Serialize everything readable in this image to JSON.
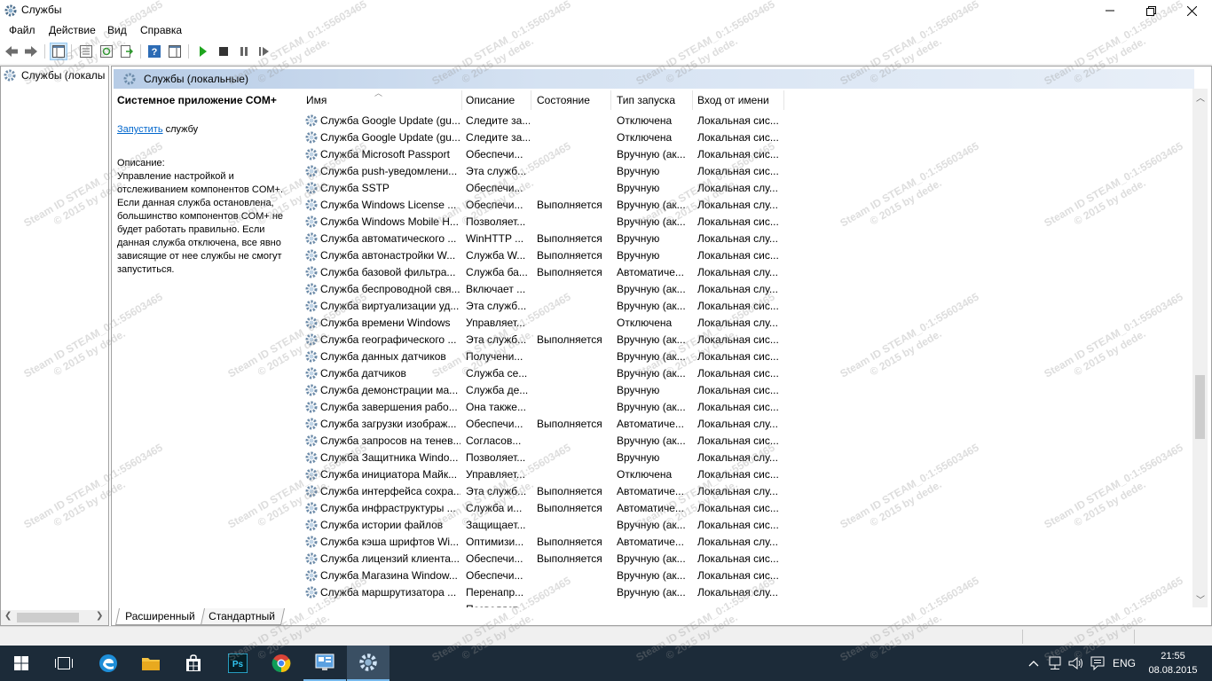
{
  "window": {
    "title": "Службы",
    "icon": "services-gear-icon"
  },
  "menu": [
    "Файл",
    "Действие",
    "Вид",
    "Справка"
  ],
  "tree": {
    "item": "Службы (локалы"
  },
  "panel": {
    "header": "Службы (локальные)"
  },
  "description": {
    "service_name": "Системное приложение COM+",
    "start_link": "Запустить",
    "start_suffix": " службу",
    "label": "Описание:",
    "text": "Управление настройкой и отслеживанием компонентов COM+. Если данная служба остановлена, большинство компонентов COM+ не будет работать правильно. Если данная служба отключена, все явно зависящие от нее службы не смогут запуститься."
  },
  "columns": [
    "Имя",
    "Описание",
    "Состояние",
    "Тип запуска",
    "Вход от имени"
  ],
  "rows": [
    [
      "Служба Google Update (gu...",
      "Следите за...",
      "",
      "Отключена",
      "Локальная сис..."
    ],
    [
      "Служба Google Update (gu...",
      "Следите за...",
      "",
      "Отключена",
      "Локальная сис..."
    ],
    [
      "Служба Microsoft Passport",
      "Обеспечи...",
      "",
      "Вручную (ак...",
      "Локальная сис..."
    ],
    [
      "Служба push-уведомлени...",
      "Эта служб...",
      "",
      "Вручную",
      "Локальная сис..."
    ],
    [
      "Служба SSTP",
      "Обеспечи...",
      "",
      "Вручную",
      "Локальная слу..."
    ],
    [
      "Служба Windows License ...",
      "Обеспечи...",
      "Выполняется",
      "Вручную (ак...",
      "Локальная слу..."
    ],
    [
      "Служба Windows Mobile H...",
      "Позволяет...",
      "",
      "Вручную (ак...",
      "Локальная сис..."
    ],
    [
      "Служба автоматического ...",
      "WinHTTP ...",
      "Выполняется",
      "Вручную",
      "Локальная слу..."
    ],
    [
      "Служба автонастройки W...",
      "Служба W...",
      "Выполняется",
      "Вручную",
      "Локальная сис..."
    ],
    [
      "Служба базовой фильтра...",
      "Служба ба...",
      "Выполняется",
      "Автоматиче...",
      "Локальная слу..."
    ],
    [
      "Служба беспроводной свя...",
      "Включает ...",
      "",
      "Вручную (ак...",
      "Локальная слу..."
    ],
    [
      "Служба виртуализации уд...",
      "Эта служб...",
      "",
      "Вручную (ак...",
      "Локальная сис..."
    ],
    [
      "Служба времени Windows",
      "Управляет...",
      "",
      "Отключена",
      "Локальная слу..."
    ],
    [
      "Служба географического ...",
      "Эта служб...",
      "Выполняется",
      "Вручную (ак...",
      "Локальная сис..."
    ],
    [
      "Служба данных датчиков",
      "Получени...",
      "",
      "Вручную (ак...",
      "Локальная сис..."
    ],
    [
      "Служба датчиков",
      "Служба се...",
      "",
      "Вручную (ак...",
      "Локальная сис..."
    ],
    [
      "Служба демонстрации ма...",
      "Служба де...",
      "",
      "Вручную",
      "Локальная сис..."
    ],
    [
      "Служба завершения рабо...",
      "Она также...",
      "",
      "Вручную (ак...",
      "Локальная сис..."
    ],
    [
      "Служба загрузки изображ...",
      "Обеспечи...",
      "Выполняется",
      "Автоматиче...",
      "Локальная слу..."
    ],
    [
      "Служба запросов на тенев...",
      "Согласов...",
      "",
      "Вручную (ак...",
      "Локальная сис..."
    ],
    [
      "Служба Защитника Windo...",
      "Позволяет...",
      "",
      "Вручную",
      "Локальная слу..."
    ],
    [
      "Служба инициатора Майк...",
      "Управляет...",
      "",
      "Отключена",
      "Локальная сис..."
    ],
    [
      "Служба интерфейса сохра...",
      "Эта служб...",
      "Выполняется",
      "Автоматиче...",
      "Локальная слу..."
    ],
    [
      "Служба инфраструктуры ...",
      "Служба и...",
      "Выполняется",
      "Автоматиче...",
      "Локальная сис..."
    ],
    [
      "Служба истории файлов",
      "Защищает...",
      "",
      "Вручную (ак...",
      "Локальная сис..."
    ],
    [
      "Служба кэша шрифтов Wi...",
      "Оптимизи...",
      "Выполняется",
      "Автоматиче...",
      "Локальная слу..."
    ],
    [
      "Служба лицензий клиента...",
      "Обеспечи...",
      "Выполняется",
      "Вручную (ак...",
      "Локальная сис..."
    ],
    [
      "Служба Магазина Window...",
      "Обеспечи...",
      "",
      "Вручную (ак...",
      "Локальная сис..."
    ],
    [
      "Служба маршрутизатора ...",
      "Перенапр...",
      "",
      "Вручную (ак...",
      "Локальная слу..."
    ],
    [
      "",
      "Позволяет...",
      "",
      "",
      ""
    ]
  ],
  "tabs": [
    "Расширенный",
    "Стандартный"
  ],
  "taskbar": {
    "lang": "ENG",
    "time": "21:55",
    "date": "08.08.2015"
  },
  "watermark": {
    "line1": "Steam ID  STEAM_0:1:55603465",
    "line2": "© 2015 by dede."
  }
}
